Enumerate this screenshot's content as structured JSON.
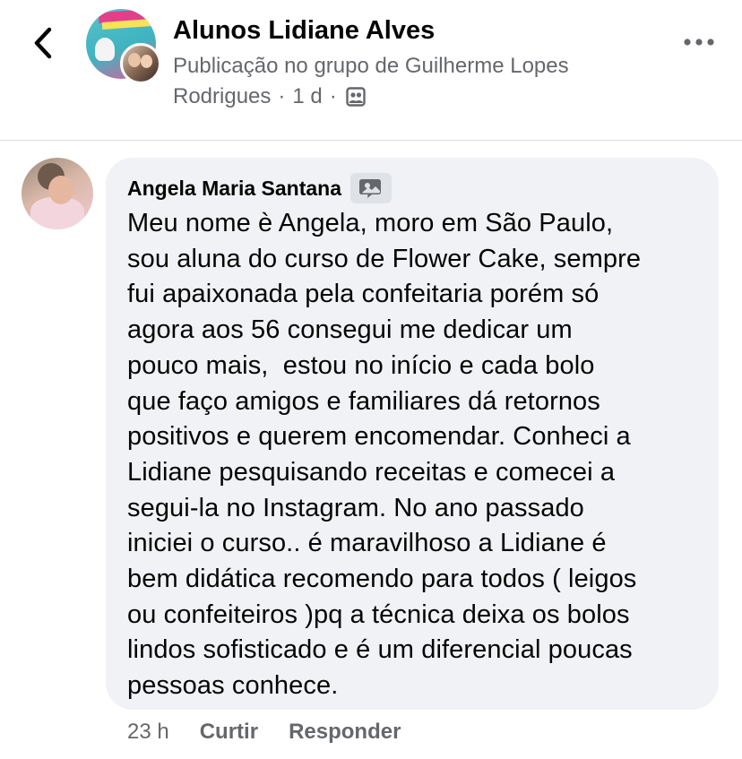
{
  "header": {
    "back_icon": "chevron-left-icon",
    "group_name": "Alunos Lidiane Alves",
    "post_context_line1": "Publicação no grupo de Guilherme Lopes",
    "post_context_author_tail": "Rodrigues",
    "separator": "·",
    "age": "1 d",
    "audience_icon": "members-only-icon",
    "more_icon": "more-horizontal-icon"
  },
  "comment": {
    "author": "Angela Maria Santana",
    "author_badge_icon": "profile-picture-frame-icon",
    "text": "Meu nome è Angela, moro em São Paulo,\nsou aluna do curso de Flower Cake, sempre\nfui apaixonada pela confeitaria porém só\nagora aos 56 consegui me dedicar um\npouco mais,  estou no início e cada bolo\nque faço amigos e familiares dá retornos\npositivos e querem encomendar. Conheci a\nLidiane pesquisando receitas e comecei a\nsegui-la no Instagram. No ano passado\niniciei o curso.. é maravilhoso a Lidiane é\nbem didática recomendo para todos ( leigos\nou confeiteiros )pq a técnica deixa os bolos\nlindos sofisticado e é um diferencial poucas\npessoas conhece.",
    "actions": {
      "time": "23 h",
      "like": "Curtir",
      "reply": "Responder"
    }
  },
  "colors": {
    "text_primary": "#050505",
    "text_secondary": "#65676b",
    "bubble_bg": "#f0f2f5",
    "divider": "#dadde1"
  }
}
